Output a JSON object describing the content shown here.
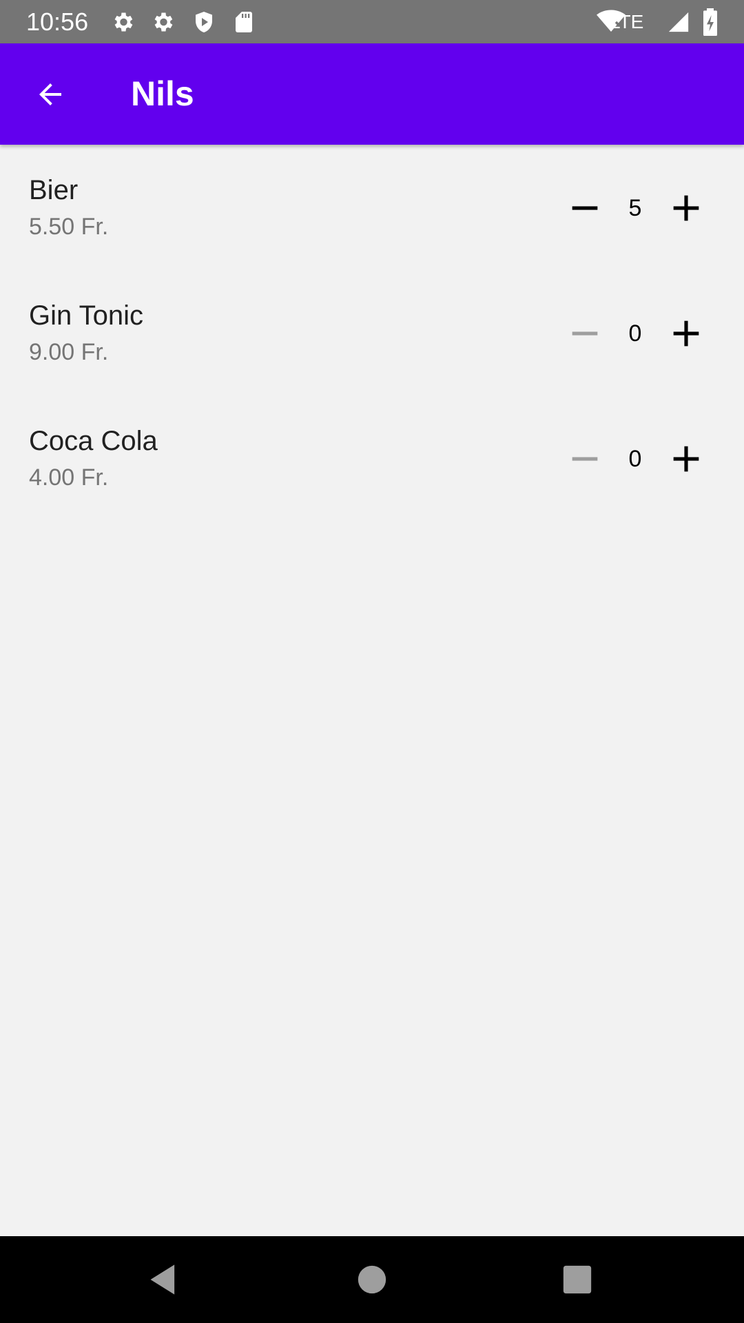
{
  "status_bar": {
    "time": "10:56",
    "network": "LTE",
    "left_icons": [
      "settings-icon",
      "settings-icon",
      "shield-icon",
      "sd-card-icon"
    ],
    "right_icons": [
      "wifi-off-icon",
      "signal-icon",
      "battery-charging-icon"
    ]
  },
  "app_bar": {
    "title": "Nils",
    "back_icon": "arrow-back-icon",
    "color": "#6200ee"
  },
  "items": [
    {
      "name": "Bier",
      "price": "5.50 Fr.",
      "quantity": "5",
      "minus_enabled": true
    },
    {
      "name": "Gin Tonic",
      "price": "9.00 Fr.",
      "quantity": "0",
      "minus_enabled": false
    },
    {
      "name": "Coca Cola",
      "price": "4.00 Fr.",
      "quantity": "0",
      "minus_enabled": false
    }
  ],
  "colors": {
    "background": "#f2f2f2",
    "status_bar": "#757575",
    "text_primary": "#212121",
    "text_secondary": "#757575",
    "disabled": "#9e9e9e"
  },
  "nav_bar": {
    "buttons": [
      "back-triangle-icon",
      "home-circle-icon",
      "recents-square-icon"
    ]
  }
}
